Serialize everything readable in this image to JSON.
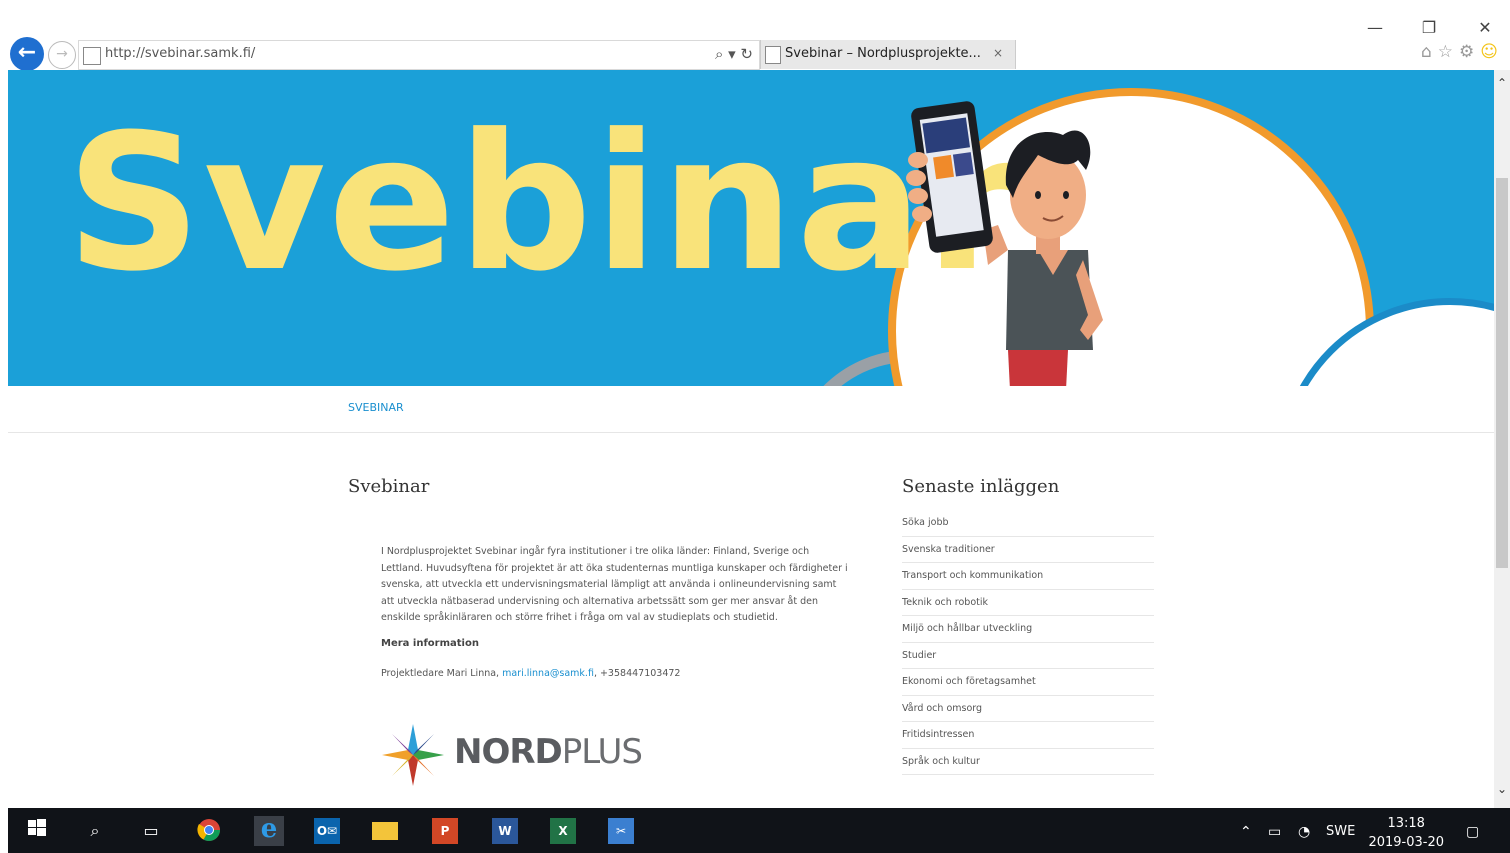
{
  "browser": {
    "url": "http://svebinar.samk.fi/",
    "tab_title": "Svebinar – Nordplusprojekte...",
    "tab_close": "×",
    "minimize": "—",
    "restore": "❐",
    "close": "✕",
    "back": "←",
    "forward": "→",
    "search_tool": "⌕ ▾",
    "refresh": "↻",
    "home_icon": "⌂",
    "favorites_icon": "☆",
    "settings_icon": "⚙",
    "smiley_icon": "☺"
  },
  "hero": {
    "title": "Svebinar",
    "colors": {
      "background": "#1ba0d8",
      "title": "#f9e37a",
      "ring_orange": "#f19a2c",
      "ring_blue": "#1b8bc8"
    }
  },
  "nav": {
    "link": "SVEBINAR"
  },
  "main": {
    "title": "Svebinar",
    "paragraph": "I Nordplusprojektet Svebinar ingår fyra institutioner i tre olika länder: Finland, Sverige och Lettland. Huvudsyftena för projektet är att öka studenternas muntliga kunskaper och färdigheter i svenska, att utveckla ett undervisningsmaterial lämpligt att använda i onlineundervisning samt att utveckla nätbaserad undervisning och alternativa arbetssätt som ger mer ansvar åt den enskilde språkinläraren och större frihet i fråga om val av studieplats och studietid.",
    "more_info": "Mera information",
    "contact_prefix": "Projektledare Mari Linna, ",
    "contact_email": "mari.linna@samk.fi",
    "contact_suffix": ", +358447103472",
    "logo_text_bold": "NORD",
    "logo_text": "PLUS"
  },
  "sidebar": {
    "title": "Senaste inläggen",
    "items": [
      "Söka jobb",
      "Svenska traditioner",
      "Transport och kommunikation",
      "Teknik och robotik",
      "Miljö och hållbar utveckling",
      "Studier",
      "Ekonomi och företagsamhet",
      "Vård och omsorg",
      "Fritidsintressen",
      "Språk och kultur"
    ]
  },
  "taskbar": {
    "language": "SWE",
    "time": "13:18",
    "date": "2019-03-20",
    "apps": [
      "start-icon",
      "search-icon",
      "task-view-icon",
      "chrome-icon",
      "internet-explorer-icon",
      "outlook-icon",
      "file-explorer-icon",
      "powerpoint-icon",
      "word-icon",
      "excel-icon",
      "snipping-tool-icon"
    ]
  },
  "scrollbar": {
    "up": "⌃",
    "down": "⌄"
  }
}
